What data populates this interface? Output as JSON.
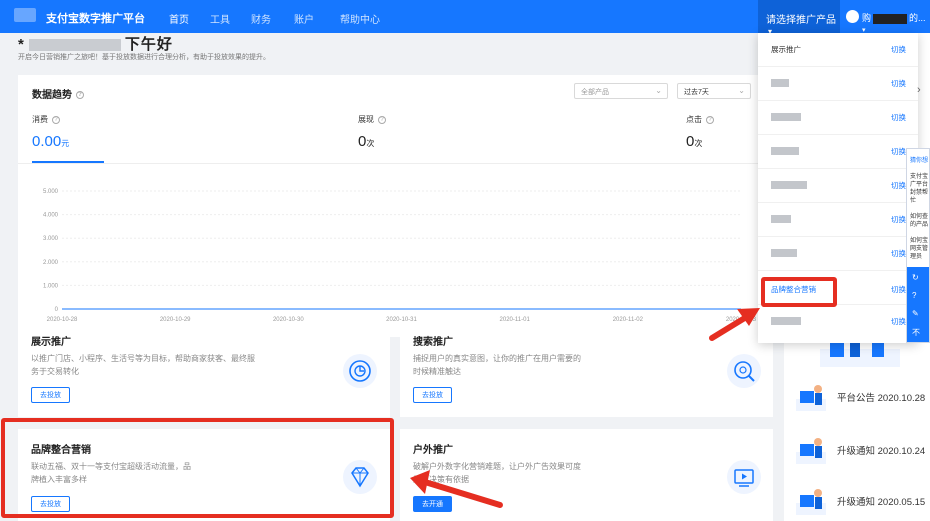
{
  "topbar": {
    "brand": "支付宝数字推广平台",
    "nav": [
      "首页",
      "工具",
      "财务",
      "账户",
      "帮助中心"
    ],
    "product_select": "请选择推广产品",
    "product_chevron": "▾",
    "user_prefix": "购",
    "user_suffix": "的...",
    "user_chevron": "▾",
    "accent": "#1677ff"
  },
  "greeting": {
    "prefix": "*",
    "suffix": "下午好",
    "subtitle": "开启今日营销推广之旅吧！基于投放数据进行合理分析，有助于投放效果的提升。"
  },
  "trend": {
    "title": "数据趋势",
    "product_filter": "全部产品",
    "range_filter": "过去7天",
    "metrics": [
      {
        "label": "消费",
        "value": "0.00",
        "unit": "元"
      },
      {
        "label": "展现",
        "value": "0",
        "unit": "次"
      },
      {
        "label": "点击",
        "value": "0",
        "unit": "次"
      }
    ]
  },
  "chart_data": {
    "type": "line",
    "x": [
      "2020-10-28",
      "2020-10-29",
      "2020-10-30",
      "2020-10-31",
      "2020-11-01",
      "2020-11-02",
      "2020-11-03"
    ],
    "y_ticks": [
      "5.000",
      "4.000",
      "3.000",
      "2.000",
      "1.000",
      "0"
    ],
    "series": [
      {
        "values": [
          0,
          0,
          0,
          0,
          0,
          0,
          0
        ]
      }
    ],
    "ylim": [
      0,
      5
    ],
    "grid": true
  },
  "cards": [
    {
      "title": "展示推广",
      "desc": "以推广门店、小程序、生活号等为目标，帮助商家获客、最终服务于交易转化",
      "button": "去投放",
      "icon": "clock-icon"
    },
    {
      "title": "搜索推广",
      "desc": "捕捉用户的真实意图，让你的推广在用户需要的时候精准触达",
      "button": "去投放",
      "icon": "search-icon"
    },
    {
      "title": "品牌整合营销",
      "desc": "联动五福、双十一等支付宝超级活动流量，品牌植入丰富多样",
      "button": "去投放",
      "icon": "diamond-icon"
    },
    {
      "title": "户外推广",
      "desc": "破解户外数字化营销难题，让户外广告效果可度量，决策有依据",
      "button": "去开通",
      "icon": "screen-icon"
    }
  ],
  "dropdown": {
    "first": {
      "name": "展示推广",
      "action": "切换"
    },
    "highlighted": {
      "name": "品牌整合营销",
      "action": "切换"
    },
    "action": "切换",
    "chevron": "›"
  },
  "help_panel": {
    "title": "猜你想",
    "items": [
      "支付宝广平台封禁帮忙",
      "如何查的产品",
      "如何宝网支管理员"
    ],
    "icons": [
      "↻",
      "?",
      "✎",
      "不"
    ]
  },
  "notices": [
    {
      "text": "平台公告 2020.10.28"
    },
    {
      "text": "升级通知 2020.10.24"
    },
    {
      "text": "升级通知 2020.05.15"
    }
  ],
  "colors": {
    "highlight": "#e52e21",
    "accent": "#1677ff"
  }
}
